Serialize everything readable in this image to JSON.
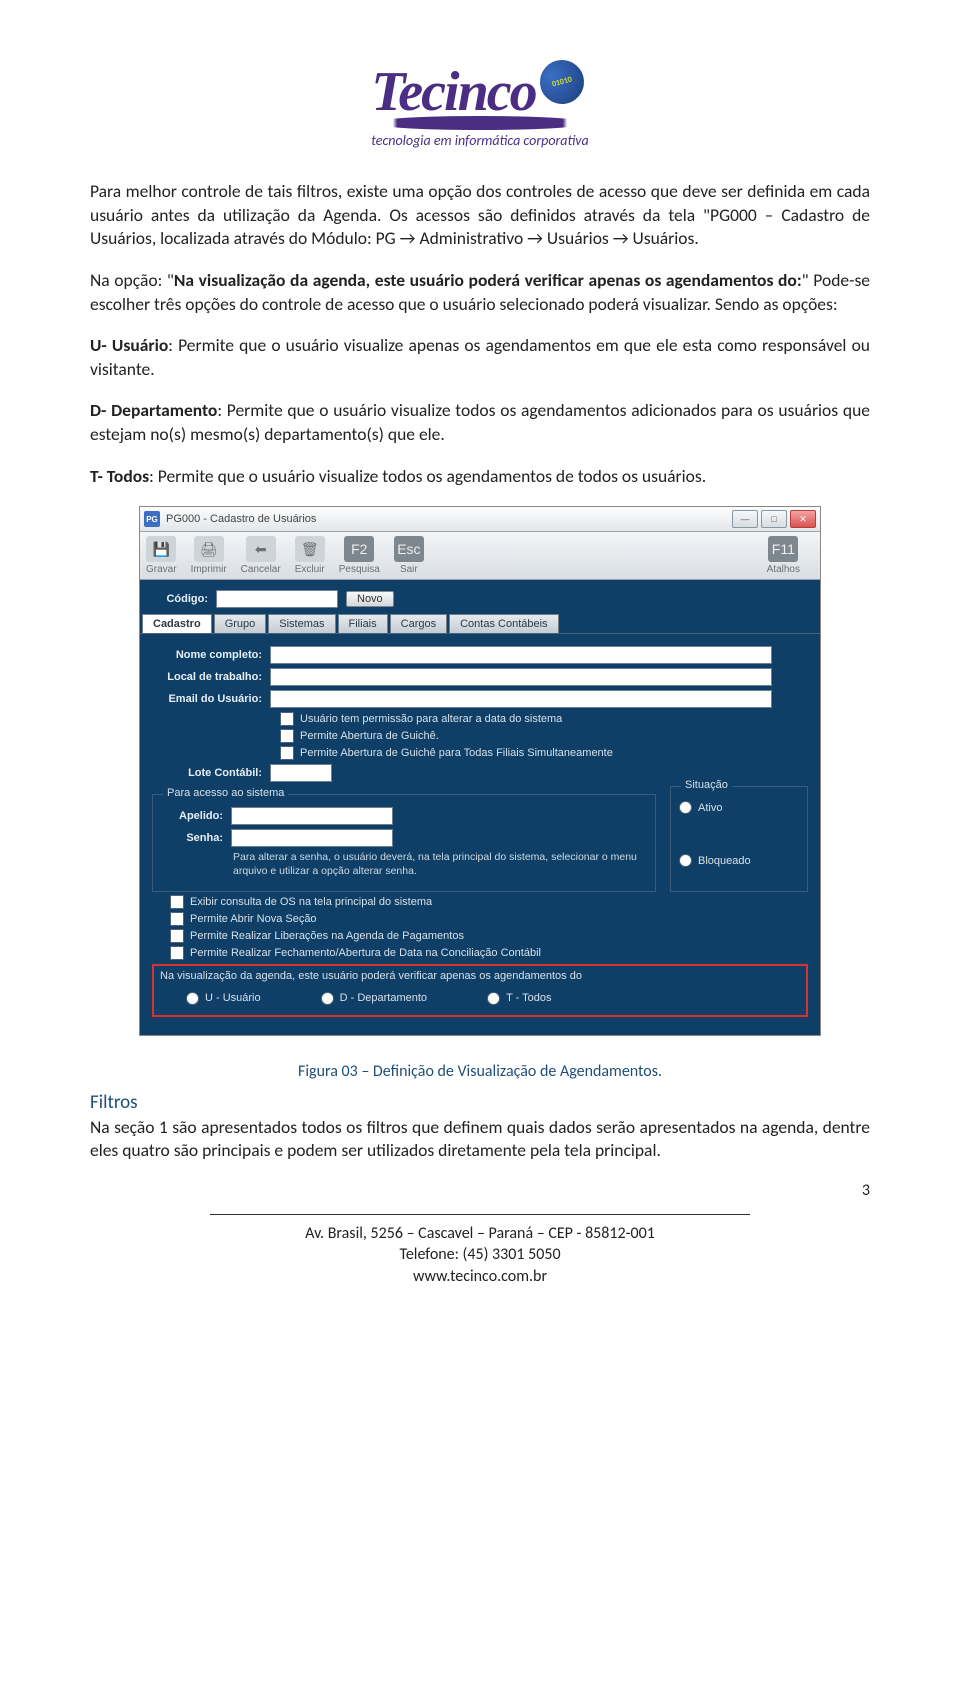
{
  "logo": {
    "brand": "Tecinco",
    "tagline": "tecnologia em informática corporativa",
    "globe_digits": "01010"
  },
  "paragraphs": {
    "p1": "Para melhor controle de tais filtros, existe uma opção dos controles de acesso que deve ser definida em cada usuário antes da utilização da Agenda. Os acessos são definidos através da tela \"PG000 – Cadastro de Usuários, localizada através do Módulo: PG → Administrativo → Usuários → Usuários.",
    "p2a": "Na opção: \"",
    "p2b": "Na visualização da agenda, este usuário poderá verificar apenas os agendamentos do:",
    "p2c": "\" Pode-se escolher três opções do controle de acesso que o usuário selecionado poderá visualizar. Sendo as opções:",
    "p3a": "U- Usuário",
    "p3b": ": Permite que o usuário visualize apenas os agendamentos em que ele esta como responsável ou visitante.",
    "p4a": "D- Departamento",
    "p4b": ": Permite que o usuário visualize todos os agendamentos adicionados para os usuários que estejam no(s) mesmo(s) departamento(s) que ele.",
    "p5a": "T- Todos",
    "p5b": ": Permite que o usuário visualize todos os agendamentos de todos os usuários."
  },
  "screenshot": {
    "title": "PG000 - Cadastro de Usuários",
    "toolbar": {
      "gravar": "Gravar",
      "imprimir": "Imprimir",
      "cancelar": "Cancelar",
      "excluir": "Excluir",
      "pesquisa": "Pesquisa",
      "pesquisa_key": "F2",
      "sair": "Sair",
      "sair_key": "Esc",
      "atalhos": "Atalhos",
      "atalhos_key": "F11"
    },
    "codigo_label": "Código:",
    "novo_btn": "Novo",
    "tabs": [
      "Cadastro",
      "Grupo",
      "Sistemas",
      "Filiais",
      "Cargos",
      "Contas Contábeis"
    ],
    "fields": {
      "nome": "Nome completo:",
      "local": "Local de trabalho:",
      "email": "Email do Usuário:",
      "lote": "Lote Contábil:"
    },
    "checks1": [
      "Usuário tem permissão para alterar a data do sistema",
      "Permite Abertura de Guichê.",
      "Permite Abertura de Guichê para Todas Filiais Simultaneamente"
    ],
    "acesso": {
      "legend": "Para acesso ao sistema",
      "apelido": "Apelido:",
      "senha": "Senha:",
      "note": "Para alterar a senha, o usuário deverá, na tela principal do sistema, selecionar o menu arquivo e utilizar a opção alterar senha."
    },
    "situacao": {
      "legend": "Situação",
      "ativo": "Ativo",
      "bloqueado": "Bloqueado"
    },
    "checks2": [
      "Exibir consulta de OS na tela principal do sistema",
      "Permite Abrir Nova Seção",
      "Permite Realizar Liberações na Agenda de Pagamentos",
      "Permite Realizar Fechamento/Abertura de Data na Conciliação Contábil"
    ],
    "highlight": {
      "head": "Na visualização da agenda, este usuário poderá verificar apenas os agendamentos do",
      "opt1": "U - Usuário",
      "opt2": "D - Departamento",
      "opt3": "T - Todos"
    }
  },
  "caption": "Figura 03 – Definição de Visualização de Agendamentos.",
  "filtros_head": "Filtros",
  "filtros_body": "Na seção 1 são apresentados todos os filtros que definem quais dados serão apresentados na agenda, dentre eles quatro são principais e podem ser utilizados diretamente pela tela principal.",
  "page_number": "3",
  "footer": {
    "line1": "Av. Brasil, 5256 – Cascavel – Paraná – CEP - 85812-001",
    "line2": "Telefone: (45) 3301 5050",
    "line3": "www.tecinco.com.br"
  }
}
